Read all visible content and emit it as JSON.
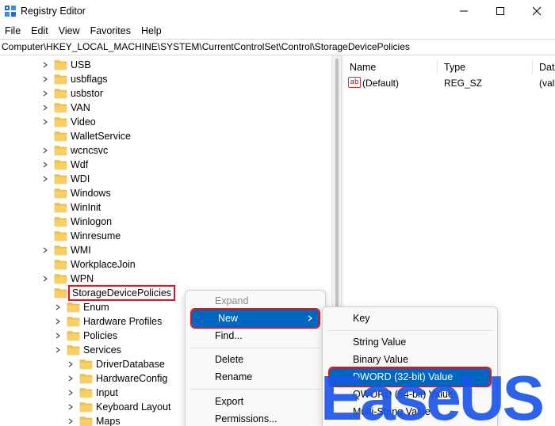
{
  "window": {
    "title": "Registry Editor",
    "minimize_icon": "minimize-icon",
    "maximize_icon": "maximize-icon",
    "close_icon": "close-icon"
  },
  "menubar": [
    "File",
    "Edit",
    "View",
    "Favorites",
    "Help"
  ],
  "address": "Computer\\HKEY_LOCAL_MACHINE\\SYSTEM\\CurrentControlSet\\Control\\StorageDevicePolicies",
  "tree": {
    "items": [
      {
        "label": "USB",
        "depth": 2,
        "expand": true
      },
      {
        "label": "usbflags",
        "depth": 2,
        "expand": true
      },
      {
        "label": "usbstor",
        "depth": 2,
        "expand": true
      },
      {
        "label": "VAN",
        "depth": 2,
        "expand": true
      },
      {
        "label": "Video",
        "depth": 2,
        "expand": true
      },
      {
        "label": "WalletService",
        "depth": 2,
        "expand": false
      },
      {
        "label": "wcncsvc",
        "depth": 2,
        "expand": true
      },
      {
        "label": "Wdf",
        "depth": 2,
        "expand": true
      },
      {
        "label": "WDI",
        "depth": 2,
        "expand": true
      },
      {
        "label": "Windows",
        "depth": 2,
        "expand": false
      },
      {
        "label": "WinInit",
        "depth": 2,
        "expand": false
      },
      {
        "label": "Winlogon",
        "depth": 2,
        "expand": false
      },
      {
        "label": "Winresume",
        "depth": 2,
        "expand": false
      },
      {
        "label": "WMI",
        "depth": 2,
        "expand": true
      },
      {
        "label": "WorkplaceJoin",
        "depth": 2,
        "expand": false
      },
      {
        "label": "WPN",
        "depth": 2,
        "expand": true
      },
      {
        "label": "StorageDevicePolicies",
        "depth": 2,
        "expand": false,
        "selected": true
      },
      {
        "label": "Enum",
        "depth": 1,
        "expand": true
      },
      {
        "label": "Hardware Profiles",
        "depth": 1,
        "expand": true
      },
      {
        "label": "Policies",
        "depth": 1,
        "expand": true
      },
      {
        "label": "Services",
        "depth": 1,
        "expand": true
      },
      {
        "label": "DriverDatabase",
        "depth": 0,
        "expand": true
      },
      {
        "label": "HardwareConfig",
        "depth": 0,
        "expand": true
      },
      {
        "label": "Input",
        "depth": 0,
        "expand": true
      },
      {
        "label": "Keyboard Layout",
        "depth": 0,
        "expand": true
      },
      {
        "label": "Maps",
        "depth": 0,
        "expand": true
      }
    ]
  },
  "values_pane": {
    "headers": [
      "Name",
      "Type",
      "Dat"
    ],
    "rows": [
      {
        "name": "(Default)",
        "type": "REG_SZ",
        "data": "(val",
        "icon": "string-value-icon"
      }
    ]
  },
  "context_menu": {
    "items": [
      {
        "label": "Expand",
        "disabled": true
      },
      {
        "label": "New",
        "highlighted": true,
        "submenu": true
      },
      {
        "label": "Find..."
      },
      {
        "label": "Delete"
      },
      {
        "label": "Rename"
      },
      {
        "label": "Export"
      },
      {
        "label": "Permissions..."
      }
    ]
  },
  "submenu": {
    "items": [
      {
        "label": "Key"
      },
      {
        "label": "String Value"
      },
      {
        "label": "Binary Value"
      },
      {
        "label": "DWORD (32-bit) Value",
        "highlighted": true
      },
      {
        "label": "QWORD (64-bit) Value"
      },
      {
        "label": "Multi-String Value"
      }
    ]
  },
  "watermark": {
    "text": "EaseUS",
    "color": "#1a56e8"
  },
  "colors": {
    "accent": "#0067c0",
    "highlight_outline": "#e0141e",
    "folder": "#f2c14e"
  }
}
